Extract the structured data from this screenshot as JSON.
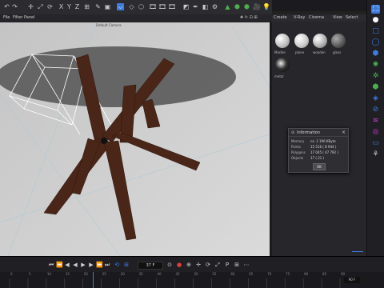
{
  "menu": {
    "items": [
      "File",
      "Filter",
      "Panel"
    ]
  },
  "viewport": {
    "camera_label": "Default Camera"
  },
  "material_panel": {
    "menu": [
      "Create",
      "V-Ray",
      "Cinema",
      "View",
      "Select"
    ],
    "materials": [
      {
        "name": "Marble",
        "color": "#d8d8d8"
      },
      {
        "name": "plane",
        "color": "#cfcfcf"
      },
      {
        "name": "wooden",
        "color": "#bdbdbd"
      },
      {
        "name": "glass",
        "color": "#6a6a6a"
      },
      {
        "name": "metal",
        "color": "#1a1a1a"
      }
    ]
  },
  "info_dialog": {
    "title": "Information",
    "rows": [
      {
        "label": "Memory",
        "value": "ca. 1 196 KByte"
      },
      {
        "label": "Points",
        "value": "15 516 ( 8 944 )"
      },
      {
        "label": "Polygons",
        "value": "17 045 ( 47 792 )"
      },
      {
        "label": "Objects",
        "value": "17 ( 21 )"
      }
    ],
    "ok_label": "OK"
  },
  "timeline": {
    "frame_display": "37 F",
    "end_frame": "90 F",
    "ruler_ticks": [
      "0",
      "5",
      "10",
      "15",
      "20",
      "25",
      "30",
      "35",
      "40",
      "45",
      "50",
      "55",
      "60",
      "65",
      "70",
      "75",
      "80",
      "85",
      "90"
    ]
  },
  "colors": {
    "accent_blue": "#3d7be0",
    "wood": "#4a2618",
    "glass_top": "#5a5a5a"
  }
}
